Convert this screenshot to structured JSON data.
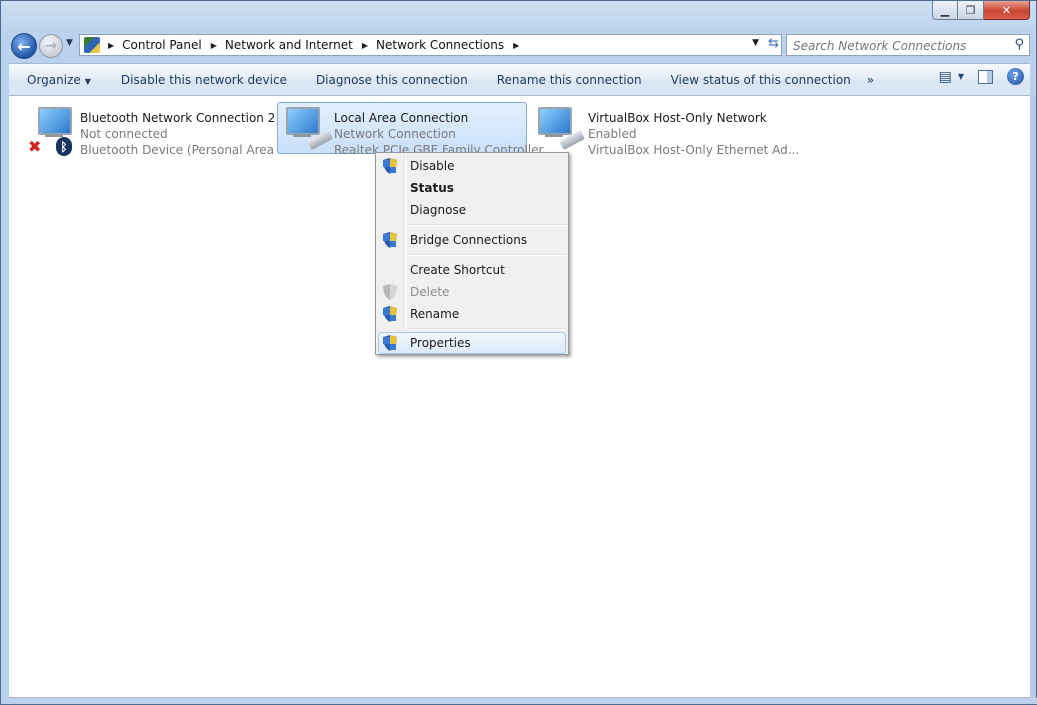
{
  "window": {
    "caption_buttons": {
      "minimize": "▁",
      "restore": "❐",
      "close": "✕"
    }
  },
  "nav": {
    "back_glyph": "←",
    "forward_glyph": "→",
    "breadcrumbs": [
      "Control Panel",
      "Network and Internet",
      "Network Connections"
    ],
    "search_placeholder": "Search Network Connections"
  },
  "command_bar": {
    "organize": "Organize",
    "items": [
      "Disable this network device",
      "Diagnose this connection",
      "Rename this connection",
      "View status of this connection"
    ],
    "more": "»"
  },
  "connections": [
    {
      "name": "Bluetooth Network Connection 2",
      "status": "Not connected",
      "device": "Bluetooth Device (Personal Area ...",
      "selected": false,
      "badge": "x"
    },
    {
      "name": "Local Area Connection",
      "status": "Network Connection",
      "device": "Realtek PCIe GBE Family Controller",
      "selected": true,
      "badge": "cable"
    },
    {
      "name": "VirtualBox Host-Only Network",
      "status": "Enabled",
      "device": "VirtualBox Host-Only Ethernet Ad...",
      "selected": false,
      "badge": "cable"
    }
  ],
  "context_menu": {
    "items": [
      {
        "label": "Disable",
        "icon": "shield-icon",
        "bold": false,
        "disabled": false
      },
      {
        "label": "Status",
        "icon": "",
        "bold": true,
        "disabled": false
      },
      {
        "label": "Diagnose",
        "icon": "",
        "bold": false,
        "disabled": false
      },
      {
        "label": "Bridge Connections",
        "icon": "shield-icon",
        "bold": false,
        "disabled": false
      },
      {
        "label": "Create Shortcut",
        "icon": "",
        "bold": false,
        "disabled": false
      },
      {
        "label": "Delete",
        "icon": "shield-icon",
        "bold": false,
        "disabled": true
      },
      {
        "label": "Rename",
        "icon": "shield-icon",
        "bold": false,
        "disabled": false
      },
      {
        "label": "Properties",
        "icon": "shield-icon",
        "bold": false,
        "disabled": false,
        "highlighted": true
      }
    ]
  }
}
